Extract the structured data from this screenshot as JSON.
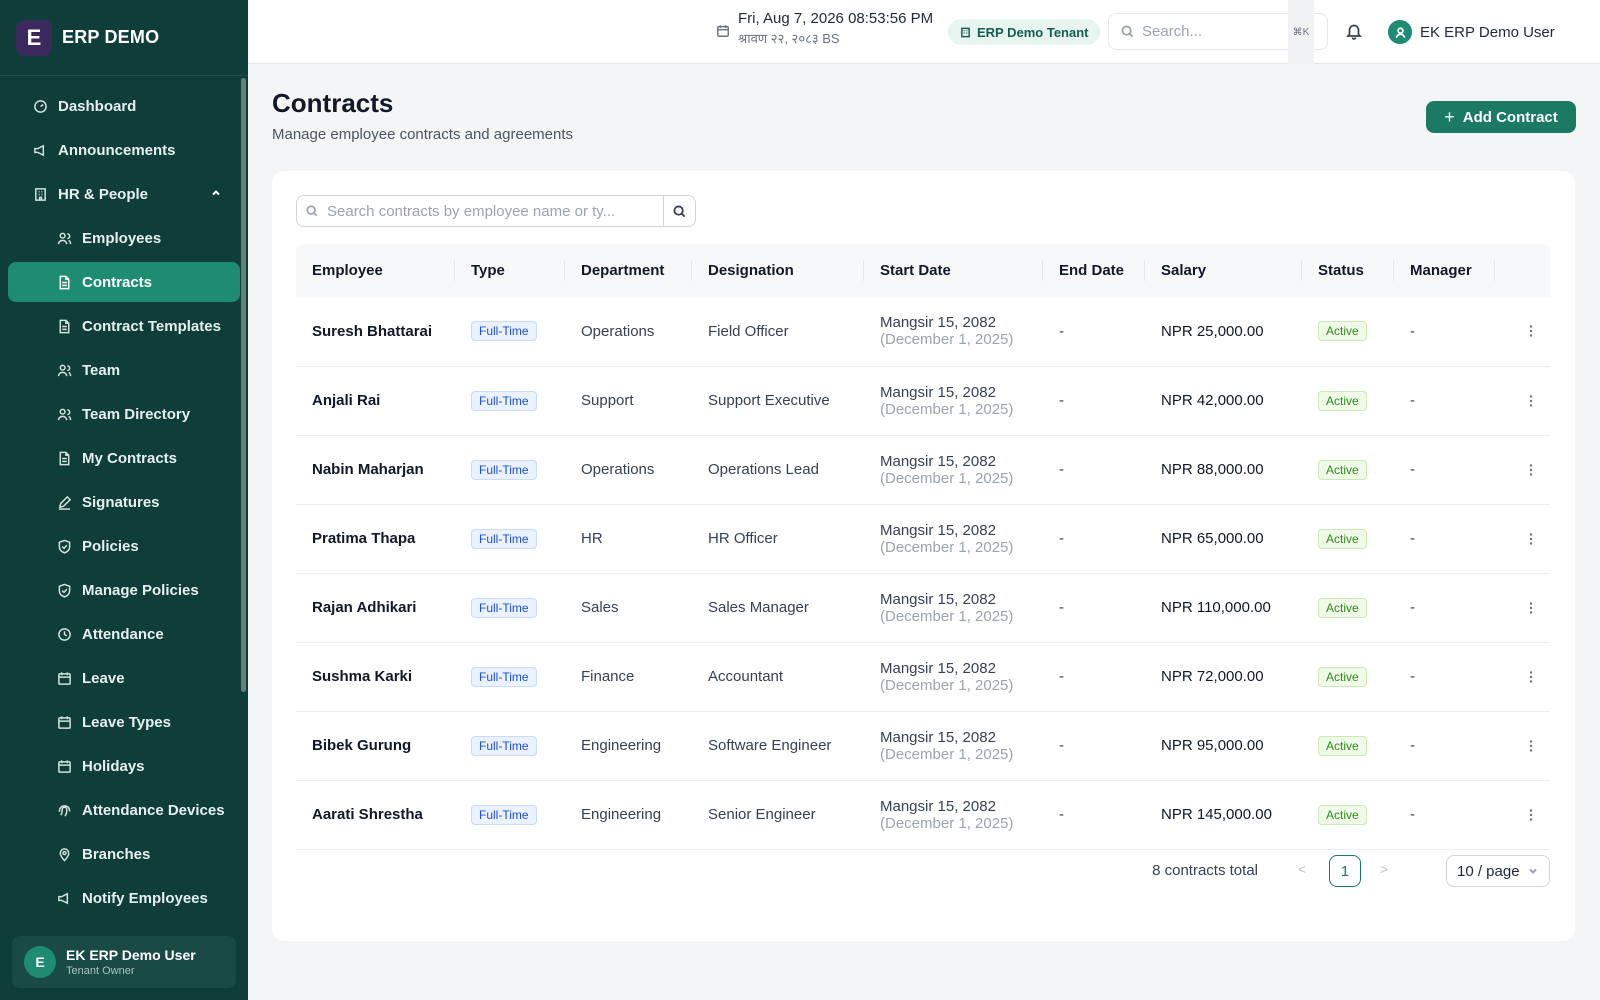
{
  "brand": {
    "name": "ERP DEMO",
    "logo_letter": "E"
  },
  "sidebar": {
    "items": [
      {
        "label": "Dashboard",
        "icon": "dashboard-icon"
      },
      {
        "label": "Announcements",
        "icon": "megaphone-icon"
      },
      {
        "label": "HR & People",
        "icon": "building-icon",
        "expanded": true
      },
      {
        "label": "Employees",
        "icon": "users-icon"
      },
      {
        "label": "Contracts",
        "icon": "document-icon",
        "active": true
      },
      {
        "label": "Contract Templates",
        "icon": "document-icon"
      },
      {
        "label": "Team",
        "icon": "users-icon"
      },
      {
        "label": "Team Directory",
        "icon": "users-icon"
      },
      {
        "label": "My Contracts",
        "icon": "document-icon"
      },
      {
        "label": "Signatures",
        "icon": "pen-icon"
      },
      {
        "label": "Policies",
        "icon": "shield-icon"
      },
      {
        "label": "Manage Policies",
        "icon": "shield-icon"
      },
      {
        "label": "Attendance",
        "icon": "clock-icon"
      },
      {
        "label": "Leave",
        "icon": "calendar-icon"
      },
      {
        "label": "Leave Types",
        "icon": "calendar-icon"
      },
      {
        "label": "Holidays",
        "icon": "calendar-icon"
      },
      {
        "label": "Attendance Devices",
        "icon": "fingerprint-icon"
      },
      {
        "label": "Branches",
        "icon": "map-pin-icon"
      },
      {
        "label": "Notify Employees",
        "icon": "megaphone-icon"
      }
    ],
    "user": {
      "avatar_letter": "E",
      "name": "EK ERP Demo User",
      "role": "Tenant Owner"
    }
  },
  "topbar": {
    "date_line": "Fri, Aug 7, 2026 08:53:56 PM",
    "date_bs": "श्रावण २२, २०८३ BS",
    "tenant": "ERP Demo Tenant",
    "search_placeholder": "Search...",
    "shortcut": "⌘K",
    "user_name": "EK ERP Demo User"
  },
  "page": {
    "title": "Contracts",
    "subtitle": "Manage employee contracts and agreements",
    "add_button": "Add Contract"
  },
  "table": {
    "search_placeholder": "Search contracts by employee name or ty...",
    "columns": [
      "Employee",
      "Type",
      "Department",
      "Designation",
      "Start Date",
      "End Date",
      "Salary",
      "Status",
      "Manager",
      ""
    ],
    "rows": [
      {
        "employee": "Suresh Bhattarai",
        "type": "Full-Time",
        "department": "Operations",
        "designation": "Field Officer",
        "start_bs": "Mangsir 15, 2082",
        "start_ad": "(December 1, 2025)",
        "end": "-",
        "salary": "NPR 25,000.00",
        "status": "Active",
        "manager": "-"
      },
      {
        "employee": "Anjali Rai",
        "type": "Full-Time",
        "department": "Support",
        "designation": "Support Executive",
        "start_bs": "Mangsir 15, 2082",
        "start_ad": "(December 1, 2025)",
        "end": "-",
        "salary": "NPR 42,000.00",
        "status": "Active",
        "manager": "-"
      },
      {
        "employee": "Nabin Maharjan",
        "type": "Full-Time",
        "department": "Operations",
        "designation": "Operations Lead",
        "start_bs": "Mangsir 15, 2082",
        "start_ad": "(December 1, 2025)",
        "end": "-",
        "salary": "NPR 88,000.00",
        "status": "Active",
        "manager": "-"
      },
      {
        "employee": "Pratima Thapa",
        "type": "Full-Time",
        "department": "HR",
        "designation": "HR Officer",
        "start_bs": "Mangsir 15, 2082",
        "start_ad": "(December 1, 2025)",
        "end": "-",
        "salary": "NPR 65,000.00",
        "status": "Active",
        "manager": "-"
      },
      {
        "employee": "Rajan Adhikari",
        "type": "Full-Time",
        "department": "Sales",
        "designation": "Sales Manager",
        "start_bs": "Mangsir 15, 2082",
        "start_ad": "(December 1, 2025)",
        "end": "-",
        "salary": "NPR 110,000.00",
        "status": "Active",
        "manager": "-"
      },
      {
        "employee": "Sushma Karki",
        "type": "Full-Time",
        "department": "Finance",
        "designation": "Accountant",
        "start_bs": "Mangsir 15, 2082",
        "start_ad": "(December 1, 2025)",
        "end": "-",
        "salary": "NPR 72,000.00",
        "status": "Active",
        "manager": "-"
      },
      {
        "employee": "Bibek Gurung",
        "type": "Full-Time",
        "department": "Engineering",
        "designation": "Software Engineer",
        "start_bs": "Mangsir 15, 2082",
        "start_ad": "(December 1, 2025)",
        "end": "-",
        "salary": "NPR 95,000.00",
        "status": "Active",
        "manager": "-"
      },
      {
        "employee": "Aarati Shrestha",
        "type": "Full-Time",
        "department": "Engineering",
        "designation": "Senior Engineer",
        "start_bs": "Mangsir 15, 2082",
        "start_ad": "(December 1, 2025)",
        "end": "-",
        "salary": "NPR 145,000.00",
        "status": "Active",
        "manager": "-"
      }
    ]
  },
  "pagination": {
    "total": "8 contracts total",
    "current_page": "1",
    "page_size": "10 / page"
  },
  "colors": {
    "sidebar_bg": "#0f3d3a",
    "accent": "#1b7a64",
    "active_nav": "#1d8c73"
  }
}
